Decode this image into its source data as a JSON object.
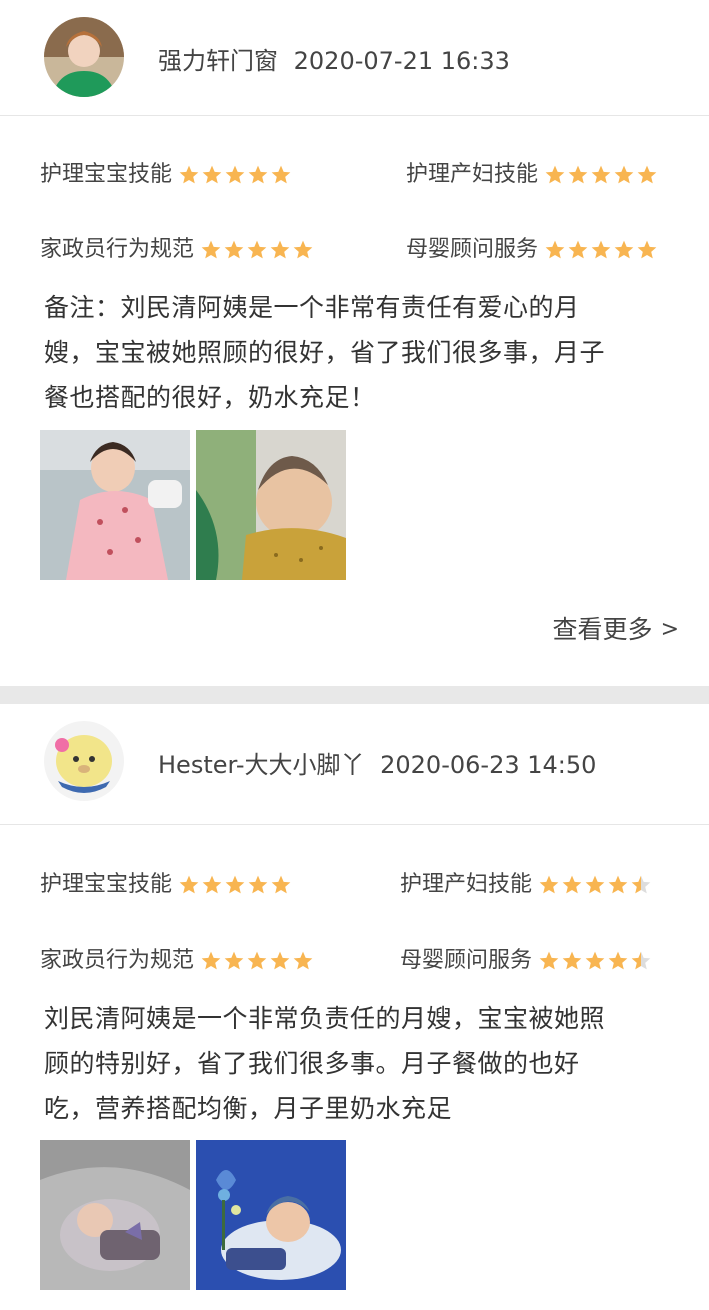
{
  "reviews": [
    {
      "user": "强力轩门窗",
      "time": "2020-07-21 16:33",
      "ratings": [
        {
          "label": "护理宝宝技能",
          "stars": 5
        },
        {
          "label": "护理产妇技能",
          "stars": 5
        },
        {
          "label": "家政员行为规范",
          "stars": 5
        },
        {
          "label": "母婴顾问服务",
          "stars": 5
        }
      ],
      "comment_lines": [
        "备注：刘民清阿姨是一个非常有责任有爱心的月",
        "嫂，宝宝被她照顾的很好，省了我们很多事，月子",
        "餐也搭配的很好，奶水充足！"
      ],
      "see_more": "查看更多",
      "see_more_icon": "chevron-right-icon"
    },
    {
      "user": "Hester-大大小脚丫",
      "time": "2020-06-23 14:50",
      "ratings": [
        {
          "label": "护理宝宝技能",
          "stars": 5
        },
        {
          "label": "护理产妇技能",
          "stars": 4.5
        },
        {
          "label": "家政员行为规范",
          "stars": 5
        },
        {
          "label": "母婴顾问服务",
          "stars": 4.5
        }
      ],
      "comment_lines": [
        "刘民清阿姨是一个非常负责任的月嫂，宝宝被她照",
        "顾的特别好，省了我们很多事。月子餐做的也好",
        "吃，营养搭配均衡，月子里奶水充足"
      ]
    }
  ],
  "colors": {
    "star": "#f8b551",
    "star_empty": "#dddddd",
    "divider": "#e6e6e6",
    "gap": "#e8e8e8"
  }
}
